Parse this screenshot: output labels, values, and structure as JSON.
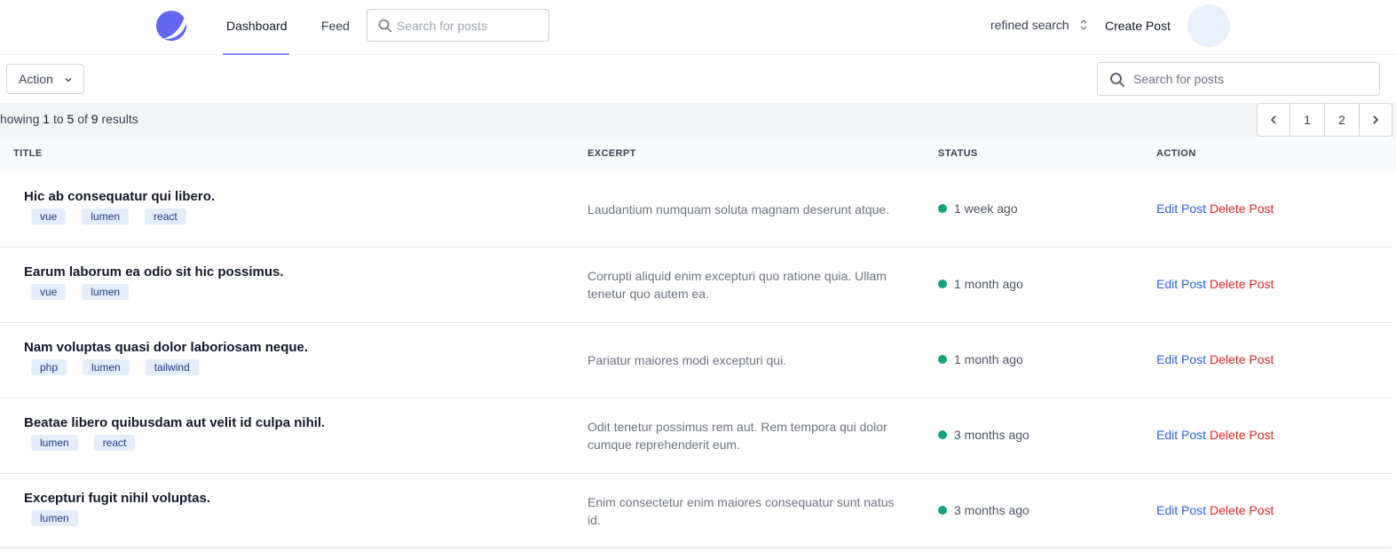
{
  "nav": {
    "tabs": [
      {
        "label": "Dashboard",
        "active": true
      },
      {
        "label": "Feed",
        "active": false
      }
    ],
    "search_placeholder": "Search for posts",
    "refined_search": "refined search",
    "create_post": "Create Post",
    "logo_icon": "moon-logo-icon",
    "accent_color": "#6366f1"
  },
  "toolbar": {
    "action_label": "Action",
    "search_placeholder": "Search for posts"
  },
  "results": {
    "prefix": "howing",
    "from": "1",
    "to_word": "to",
    "to": "5",
    "of_word": "of",
    "total": "9",
    "suffix": "results"
  },
  "pagination": {
    "pages": [
      "1",
      "2"
    ]
  },
  "table": {
    "columns": [
      "TITLE",
      "EXCERPT",
      "STATUS",
      "ACTION"
    ],
    "rows": [
      {
        "title": "Hic ab consequatur qui libero.",
        "tags": [
          "vue",
          "lumen",
          "react"
        ],
        "excerpt": "Laudantium numquam soluta magnam deserunt atque.",
        "status": "1 week ago",
        "edit": "Edit Post",
        "delete": "Delete Post"
      },
      {
        "title": "Earum laborum ea odio sit hic possimus.",
        "tags": [
          "vue",
          "lumen"
        ],
        "excerpt": "Corrupti aliquid enim excepturi quo ratione quia. Ullam tenetur quo autem ea.",
        "status": "1 month ago",
        "edit": "Edit Post",
        "delete": "Delete Post"
      },
      {
        "title": "Nam voluptas quasi dolor laboriosam neque.",
        "tags": [
          "php",
          "lumen",
          "tailwind"
        ],
        "excerpt": "Pariatur maiores modi excepturi qui.",
        "status": "1 month ago",
        "edit": "Edit Post",
        "delete": "Delete Post"
      },
      {
        "title": "Beatae libero quibusdam aut velit id culpa nihil.",
        "tags": [
          "lumen",
          "react"
        ],
        "excerpt": "Odit tenetur possimus rem aut. Rem tempora qui dolor cumque reprehenderit eum.",
        "status": "3 months ago",
        "edit": "Edit Post",
        "delete": "Delete Post"
      },
      {
        "title": "Excepturi fugit nihil voluptas.",
        "tags": [
          "lumen"
        ],
        "excerpt": "Enim consectetur enim maiores consequatur sunt natus id.",
        "status": "3 months ago",
        "edit": "Edit Post",
        "delete": "Delete Post"
      }
    ]
  },
  "colors": {
    "status_dot": "#10a37f",
    "edit_link": "#2563eb",
    "delete_link": "#dc2626",
    "tag_bg": "#e3edfb"
  }
}
